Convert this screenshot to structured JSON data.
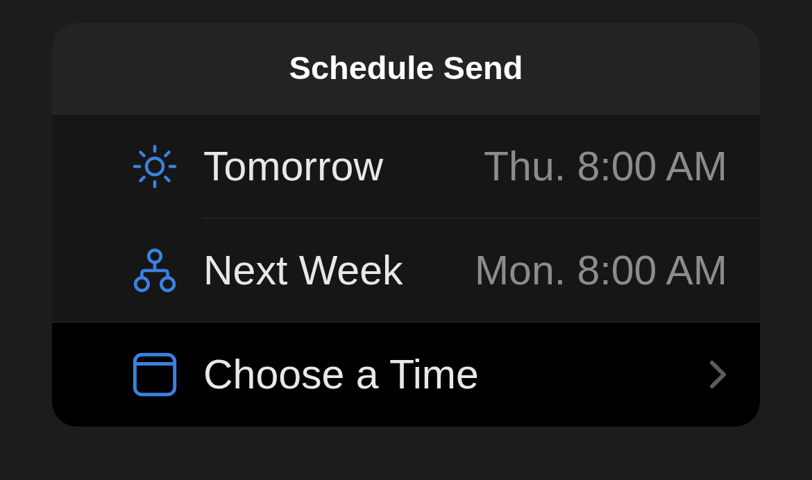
{
  "sheet": {
    "title": "Schedule Send"
  },
  "items": [
    {
      "kind": "preset",
      "label": "Tomorrow",
      "time": "Thu. 8:00 AM",
      "selected": false
    },
    {
      "kind": "preset",
      "label": "Next Week",
      "time": "Mon. 8:00 AM",
      "selected": false
    },
    {
      "kind": "picker",
      "label": "Choose a Time",
      "selected": true
    }
  ]
}
